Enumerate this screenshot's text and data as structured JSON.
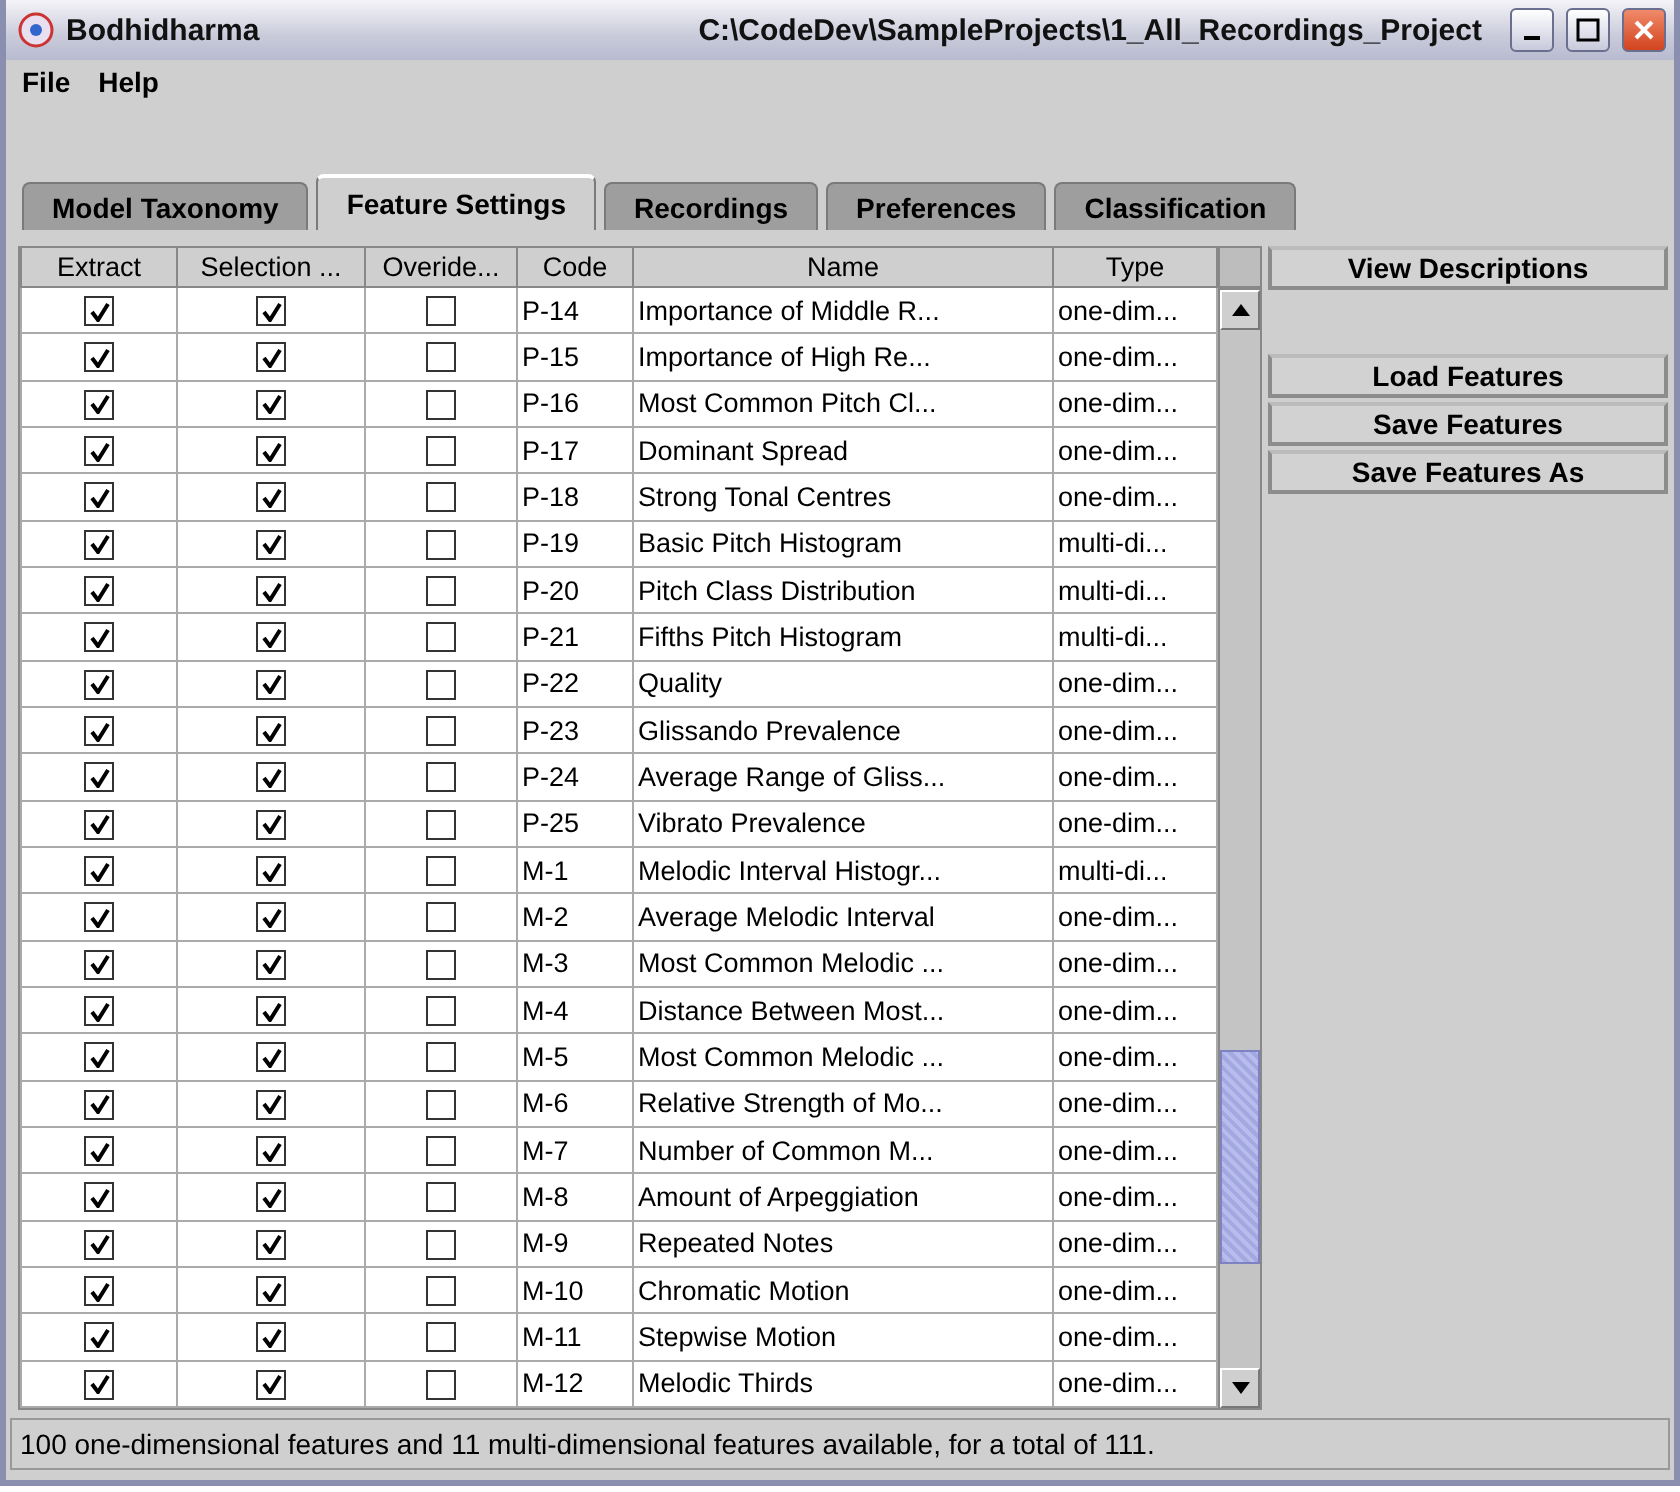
{
  "window": {
    "title": "Bodhidharma",
    "path": "C:\\CodeDev\\SampleProjects\\1_All_Recordings_Project"
  },
  "menu": [
    {
      "label": "File"
    },
    {
      "label": "Help"
    }
  ],
  "tabs": [
    {
      "label": "Model Taxonomy",
      "selected": false
    },
    {
      "label": "Feature Settings",
      "selected": true
    },
    {
      "label": "Recordings",
      "selected": false
    },
    {
      "label": "Preferences",
      "selected": false
    },
    {
      "label": "Classification",
      "selected": false
    }
  ],
  "table": {
    "columns": [
      "Extract",
      "Selection ...",
      "Overide...",
      "Code",
      "Name",
      "Type"
    ],
    "rows": [
      {
        "extract": true,
        "selection": true,
        "overide": false,
        "code": "P-14",
        "name": "Importance of Middle R...",
        "type": "one-dim..."
      },
      {
        "extract": true,
        "selection": true,
        "overide": false,
        "code": "P-15",
        "name": "Importance of High Re...",
        "type": "one-dim..."
      },
      {
        "extract": true,
        "selection": true,
        "overide": false,
        "code": "P-16",
        "name": "Most Common Pitch Cl...",
        "type": "one-dim..."
      },
      {
        "extract": true,
        "selection": true,
        "overide": false,
        "code": "P-17",
        "name": "Dominant Spread",
        "type": "one-dim..."
      },
      {
        "extract": true,
        "selection": true,
        "overide": false,
        "code": "P-18",
        "name": "Strong Tonal Centres",
        "type": "one-dim..."
      },
      {
        "extract": true,
        "selection": true,
        "overide": false,
        "code": "P-19",
        "name": "Basic Pitch Histogram",
        "type": "multi-di..."
      },
      {
        "extract": true,
        "selection": true,
        "overide": false,
        "code": "P-20",
        "name": "Pitch Class Distribution",
        "type": "multi-di..."
      },
      {
        "extract": true,
        "selection": true,
        "overide": false,
        "code": "P-21",
        "name": "Fifths Pitch Histogram",
        "type": "multi-di..."
      },
      {
        "extract": true,
        "selection": true,
        "overide": false,
        "code": "P-22",
        "name": "Quality",
        "type": "one-dim..."
      },
      {
        "extract": true,
        "selection": true,
        "overide": false,
        "code": "P-23",
        "name": "Glissando Prevalence",
        "type": "one-dim..."
      },
      {
        "extract": true,
        "selection": true,
        "overide": false,
        "code": "P-24",
        "name": "Average Range of Gliss...",
        "type": "one-dim..."
      },
      {
        "extract": true,
        "selection": true,
        "overide": false,
        "code": "P-25",
        "name": "Vibrato Prevalence",
        "type": "one-dim..."
      },
      {
        "extract": true,
        "selection": true,
        "overide": false,
        "code": "M-1",
        "name": "Melodic Interval Histogr...",
        "type": "multi-di..."
      },
      {
        "extract": true,
        "selection": true,
        "overide": false,
        "code": "M-2",
        "name": "Average Melodic Interval",
        "type": "one-dim..."
      },
      {
        "extract": true,
        "selection": true,
        "overide": false,
        "code": "M-3",
        "name": "Most Common Melodic ...",
        "type": "one-dim..."
      },
      {
        "extract": true,
        "selection": true,
        "overide": false,
        "code": "M-4",
        "name": "Distance Between Most...",
        "type": "one-dim..."
      },
      {
        "extract": true,
        "selection": true,
        "overide": false,
        "code": "M-5",
        "name": "Most Common Melodic ...",
        "type": "one-dim..."
      },
      {
        "extract": true,
        "selection": true,
        "overide": false,
        "code": "M-6",
        "name": "Relative Strength of Mo...",
        "type": "one-dim..."
      },
      {
        "extract": true,
        "selection": true,
        "overide": false,
        "code": "M-7",
        "name": "Number of Common M...",
        "type": "one-dim..."
      },
      {
        "extract": true,
        "selection": true,
        "overide": false,
        "code": "M-8",
        "name": "Amount of Arpeggiation",
        "type": "one-dim..."
      },
      {
        "extract": true,
        "selection": true,
        "overide": false,
        "code": "M-9",
        "name": "Repeated Notes",
        "type": "one-dim..."
      },
      {
        "extract": true,
        "selection": true,
        "overide": false,
        "code": "M-10",
        "name": "Chromatic Motion",
        "type": "one-dim..."
      },
      {
        "extract": true,
        "selection": true,
        "overide": false,
        "code": "M-11",
        "name": "Stepwise Motion",
        "type": "one-dim..."
      },
      {
        "extract": true,
        "selection": true,
        "overide": false,
        "code": "M-12",
        "name": "Melodic Thirds",
        "type": "one-dim..."
      }
    ]
  },
  "side_panel": {
    "view_button": "View Descriptions",
    "file_buttons": [
      "Load Features",
      "Save Features",
      "Save Features As"
    ]
  },
  "status_bar": "100 one-dimensional features and 11 multi-dimensional features available, for a total of 111."
}
